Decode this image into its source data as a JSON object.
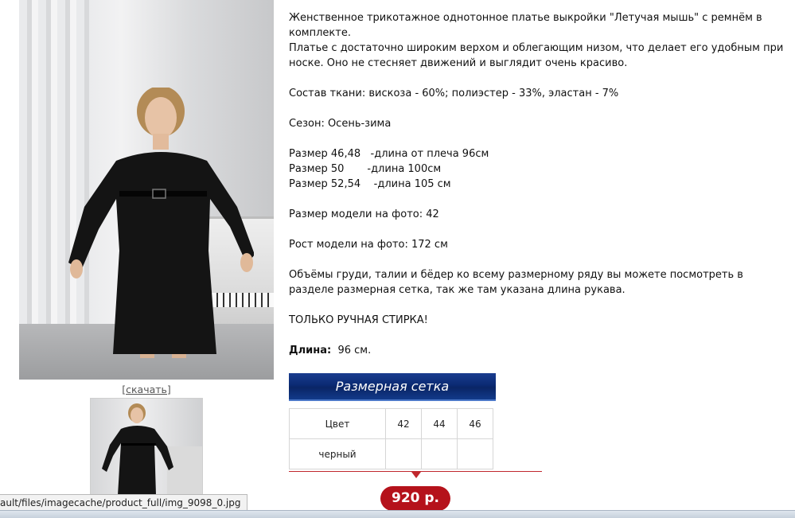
{
  "product": {
    "description": [
      "Женственное трикотажное однотонное платье выкройки \"Летучая мышь\" с ремнём в комплекте.",
      "Платье с достаточно широким верхом и облегающим низом, что делает его удобным при носке. Оно не стесняет движений и выглядит очень красиво.",
      "Состав ткани: вискоза - 60%; полиэстер - 33%, эластан - 7%",
      "Сезон: Осень-зима",
      "Размер 46,48   -длина от плеча 96см",
      "Размер 50       -длина 100см",
      "Размер 52,54    -длина 105 см",
      "Размер модели на фото: 42",
      "Рост модели на фото: 172 см",
      "Объёмы груди, талии и бёдер ко всему размерному ряду вы можете посмотреть в разделе размерная сетка, так же там указана длина рукава.",
      "ТОЛЬКО РУЧНАЯ СТИРКА!"
    ],
    "length_label": "Длина:",
    "length_value": "96 см.",
    "download_label": "[скачать]",
    "size_chart_button": "Размерная сетка",
    "table": {
      "color_header": "Цвет",
      "sizes": [
        "42",
        "44",
        "46"
      ],
      "row_color": "черный"
    },
    "price": "920 р."
  },
  "statusbar": {
    "url": "ault/files/imagecache/product_full/img_9098_0.jpg"
  },
  "colors": {
    "button_blue": "#0b2a73",
    "price_red": "#b5121b",
    "accent_red": "#c0272d"
  }
}
